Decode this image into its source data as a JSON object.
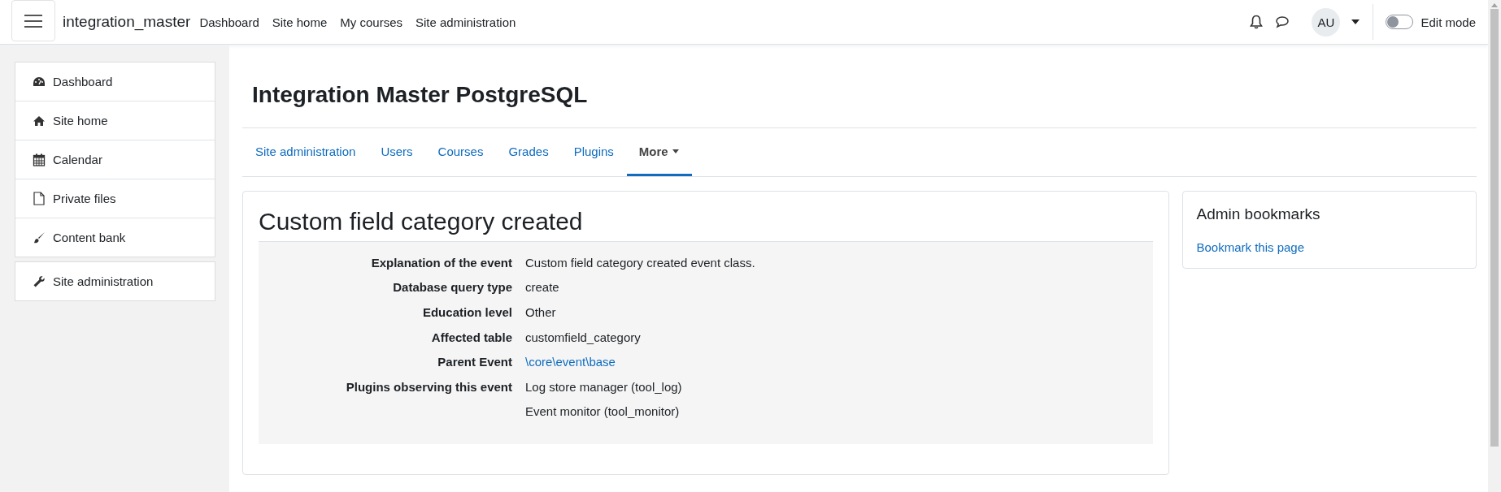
{
  "navbar": {
    "site_name": "integration_master",
    "links": [
      "Dashboard",
      "Site home",
      "My courses",
      "Site administration"
    ],
    "user_initials": "AU",
    "edit_mode": {
      "label": "Edit mode",
      "on": false
    }
  },
  "sidebar": {
    "groups": [
      {
        "items": [
          {
            "label": "Dashboard",
            "kind": "dashboard"
          },
          {
            "label": "Site home",
            "kind": "home"
          },
          {
            "label": "Calendar",
            "kind": "calendar"
          },
          {
            "label": "Private files",
            "kind": "file"
          },
          {
            "label": "Content bank",
            "kind": "brush"
          }
        ]
      },
      {
        "items": [
          {
            "label": "Site administration",
            "kind": "wrench"
          }
        ]
      }
    ]
  },
  "page_title": "Integration Master PostgreSQL",
  "tabs": [
    {
      "label": "Site administration",
      "selected": false,
      "dropdown": false
    },
    {
      "label": "Users",
      "selected": false,
      "dropdown": false
    },
    {
      "label": "Courses",
      "selected": false,
      "dropdown": false
    },
    {
      "label": "Grades",
      "selected": false,
      "dropdown": false
    },
    {
      "label": "Plugins",
      "selected": false,
      "dropdown": false
    },
    {
      "label": "More",
      "selected": true,
      "dropdown": true
    }
  ],
  "event": {
    "title": "Custom field category created",
    "rows": [
      {
        "label": "Explanation of the event",
        "value": {
          "text": "Custom field category created event class.",
          "kind": "text"
        }
      },
      {
        "label": "Database query type",
        "value": {
          "text": "create",
          "kind": "text"
        }
      },
      {
        "label": "Education level",
        "value": {
          "text": "Other",
          "kind": "text"
        }
      },
      {
        "label": "Affected table",
        "value": {
          "text": "customfield_category",
          "kind": "text"
        }
      },
      {
        "label": "Parent Event",
        "value": {
          "text": "\\core\\event\\base",
          "kind": "link"
        }
      },
      {
        "label": "Plugins observing this event",
        "value": {
          "text": "Log store manager (tool_log)",
          "kind": "text"
        }
      },
      {
        "label": "",
        "value": {
          "text": "Event monitor (tool_monitor)",
          "kind": "text"
        }
      }
    ]
  },
  "bookmarks": {
    "title": "Admin bookmarks",
    "link": "Bookmark this page"
  }
}
